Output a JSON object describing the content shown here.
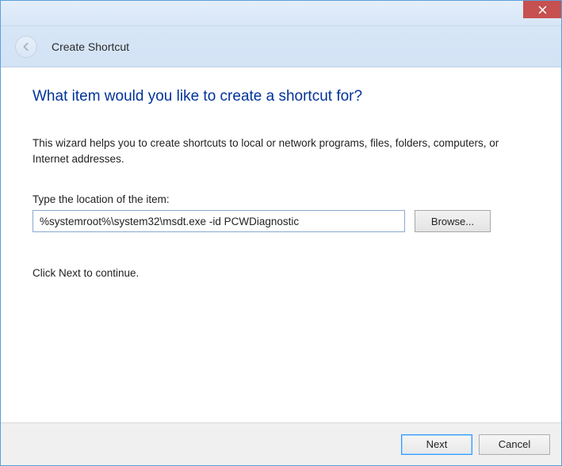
{
  "titlebar": {
    "close_icon": "close"
  },
  "header": {
    "title": "Create Shortcut",
    "back_icon": "arrow-left"
  },
  "main": {
    "heading": "What item would you like to create a shortcut for?",
    "description": "This wizard helps you to create shortcuts to local or network programs, files, folders, computers, or Internet addresses.",
    "location_label": "Type the location of the item:",
    "location_value": "%systemroot%\\system32\\msdt.exe -id PCWDiagnostic",
    "browse_label": "Browse...",
    "continue_hint": "Click Next to continue."
  },
  "footer": {
    "next_label": "Next",
    "cancel_label": "Cancel"
  }
}
